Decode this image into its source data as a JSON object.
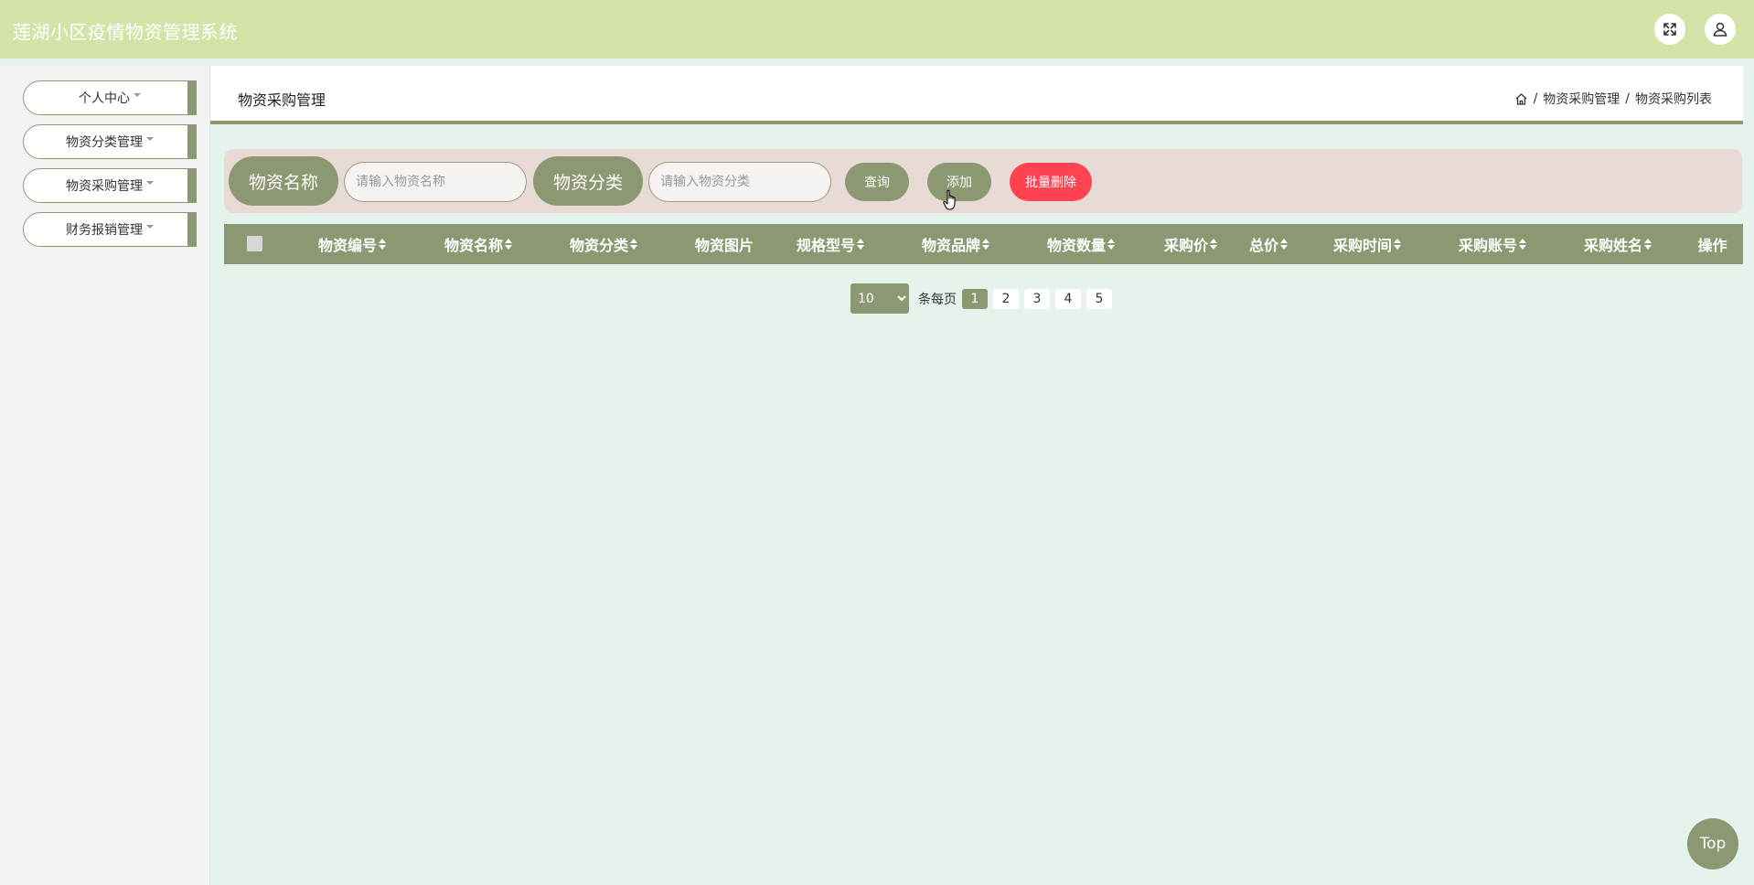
{
  "app": {
    "title": "莲湖小区疫情物资管理系统"
  },
  "header": {
    "fullscreen_icon": "expand-icon",
    "user_icon": "user-icon"
  },
  "sidebar": {
    "items": [
      {
        "label": "个人中心"
      },
      {
        "label": "物资分类管理"
      },
      {
        "label": "物资采购管理"
      },
      {
        "label": "财务报销管理"
      }
    ]
  },
  "page": {
    "title": "物资采购管理",
    "breadcrumb": {
      "home_icon": "home-icon",
      "sep": "/",
      "level1": "物资采购管理",
      "level2": "物资采购列表"
    }
  },
  "search": {
    "name_label": "物资名称",
    "name_placeholder": "请输入物资名称",
    "category_label": "物资分类",
    "category_placeholder": "请输入物资分类",
    "query_button": "查询",
    "add_button": "添加",
    "batch_delete_button": "批量删除"
  },
  "table": {
    "columns": [
      "物资编号",
      "物资名称",
      "物资分类",
      "物资图片",
      "规格型号",
      "物资品牌",
      "物资数量",
      "采购价",
      "总价",
      "采购时间",
      "采购账号",
      "采购姓名",
      "操作"
    ]
  },
  "pagination": {
    "page_size": "10",
    "per_page_label": "条每页",
    "pages": [
      "1",
      "2",
      "3",
      "4",
      "5"
    ],
    "current_page": "1"
  },
  "scroll_top": {
    "label": "Top"
  },
  "colors": {
    "header_bg": "#d4e3a8",
    "accent": "#8c9871",
    "danger": "#ff4350",
    "search_bg": "#e8dbd6",
    "content_bg": "#e6f3ec"
  }
}
